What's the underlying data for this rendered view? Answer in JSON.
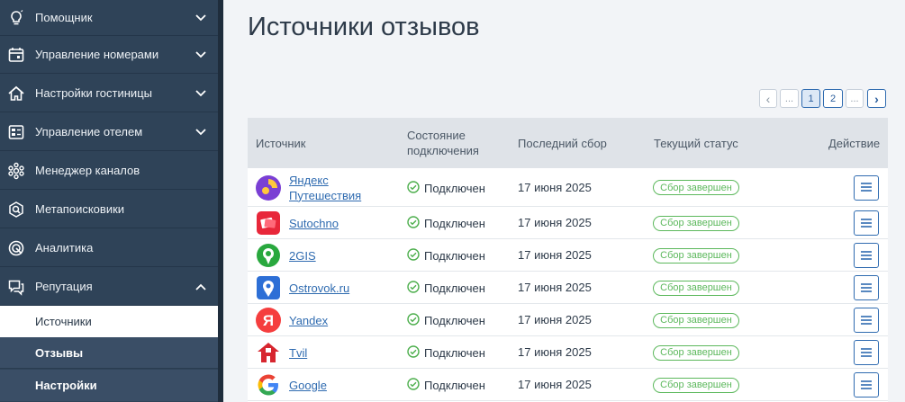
{
  "sidebar": {
    "items": [
      {
        "label": "Помощник",
        "icon": "lightbulb-icon"
      },
      {
        "label": "Управление номерами",
        "icon": "calendar-icon"
      },
      {
        "label": "Настройки гостиницы",
        "icon": "house-icon"
      },
      {
        "label": "Управление отелем",
        "icon": "grid-icon"
      },
      {
        "label": "Менеджер каналов",
        "icon": "network-icon"
      },
      {
        "label": "Метапоисковики",
        "icon": "search-icon"
      },
      {
        "label": "Аналитика",
        "icon": "target-icon"
      },
      {
        "label": "Репутация",
        "icon": "chat-icon"
      }
    ],
    "sub_items": [
      {
        "label": "Источники",
        "active": true
      },
      {
        "label": "Отзывы",
        "active": false
      },
      {
        "label": "Настройки",
        "active": false
      }
    ]
  },
  "page": {
    "title": "Источники отзывов"
  },
  "pagination": {
    "prev": "‹",
    "ellipsis_left": "...",
    "pages": [
      "1",
      "2"
    ],
    "current": "1",
    "ellipsis_right": "...",
    "next": "›"
  },
  "table": {
    "headers": {
      "source": "Источник",
      "connection_line1": "Состояние",
      "connection_line2": "подключения",
      "last_collect": "Последний сбор",
      "status": "Текущий статус",
      "action": "Действие"
    },
    "rows": [
      {
        "source_line1": "Яндекс",
        "source_line2": "Путешествия",
        "connection": "Подключен",
        "date": "17 июня 2025",
        "status": "Сбор завершен",
        "logo_icon": "yandex-travel-logo-icon",
        "logo_color": "#6f3ccf"
      },
      {
        "source_line1": "Sutochno",
        "source_line2": "",
        "connection": "Подключен",
        "date": "17 июня 2025",
        "status": "Сбор завершен",
        "logo_icon": "sutochno-logo-icon",
        "logo_color": "#e8273a"
      },
      {
        "source_line1": "2GIS",
        "source_line2": "",
        "connection": "Подключен",
        "date": "17 июня 2025",
        "status": "Сбор завершен",
        "logo_icon": "2gis-logo-icon",
        "logo_color": "#29a83e"
      },
      {
        "source_line1": "Ostrovok.ru",
        "source_line2": "",
        "connection": "Подключен",
        "date": "17 июня 2025",
        "status": "Сбор завершен",
        "logo_icon": "ostrovok-logo-icon",
        "logo_color": "#2d6fd6"
      },
      {
        "source_line1": "Yandex",
        "source_line2": "",
        "connection": "Подключен",
        "date": "17 июня 2025",
        "status": "Сбор завершен",
        "logo_icon": "yandex-logo-icon",
        "logo_color": "#f53e3e"
      },
      {
        "source_line1": "Tvil",
        "source_line2": "",
        "connection": "Подключен",
        "date": "17 июня 2025",
        "status": "Сбор завершен",
        "logo_icon": "tvil-logo-icon",
        "logo_color": "#d7262f"
      },
      {
        "source_line1": "Google",
        "source_line2": "",
        "connection": "Подключен",
        "date": "17 июня 2025",
        "status": "Сбор завершен",
        "logo_icon": "google-logo-icon",
        "logo_color": "#4285f4"
      }
    ]
  },
  "colors": {
    "sidebar": "#2f4358",
    "accent": "#2f6bb0",
    "success": "#5cb85c"
  }
}
